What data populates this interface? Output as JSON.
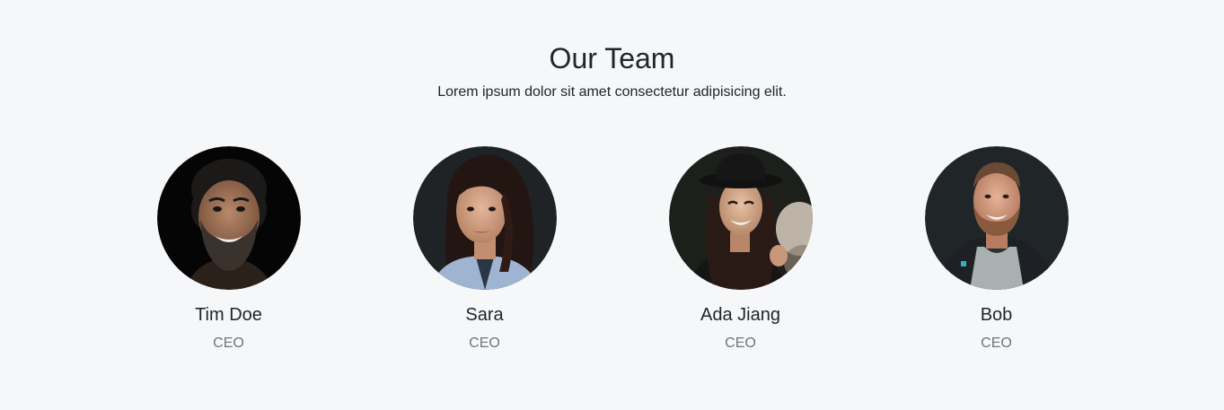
{
  "section": {
    "title": "Our Team",
    "subtitle": "Lorem ipsum dolor sit amet consectetur adipisicing elit."
  },
  "team": [
    {
      "name": "Tim Doe",
      "role": "CEO",
      "photo": "photo of bearded smiling man on black background"
    },
    {
      "name": "Sara",
      "role": "CEO",
      "photo": "photo of woman with long dark hair in blue shirt"
    },
    {
      "name": "Ada Jiang",
      "role": "CEO",
      "photo": "photo of smiling woman wearing black hat"
    },
    {
      "name": "Bob",
      "role": "CEO",
      "photo": "photo of smiling man in hoodie on dark background"
    }
  ],
  "colors": {
    "background": "#f6f7f9",
    "text": "#212529",
    "muted": "#6c757d"
  }
}
